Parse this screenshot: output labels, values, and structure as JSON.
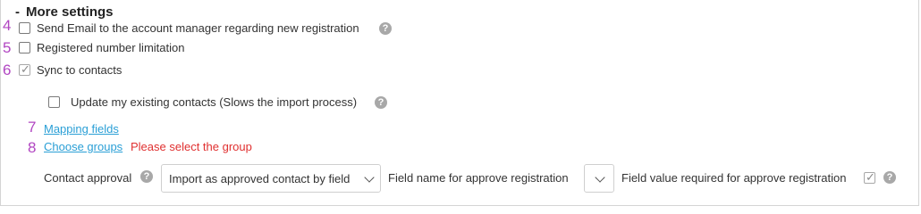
{
  "theme": {
    "number_color": "#b146c2",
    "link_color": "#2a9fd6",
    "error_color": "#e03030",
    "help_color": "#a8a8a8"
  },
  "section": {
    "collapse_glyph": "-",
    "title": "More settings"
  },
  "options": [
    {
      "number": "4",
      "label": "Send Email to the account manager regarding new registration",
      "checked": false
    },
    {
      "number": "5",
      "label": "Registered number limitation",
      "checked": false
    },
    {
      "number": "6",
      "label": "Sync to contacts",
      "checked": true
    }
  ],
  "update_contacts": {
    "label": "Update my existing contacts (Slows the import process)",
    "checked": false
  },
  "mapping": {
    "number": "7",
    "link": "Mapping fields"
  },
  "groups": {
    "number": "8",
    "link": "Choose groups",
    "error": "Please select the group"
  },
  "approval": {
    "label": "Contact approval",
    "select_value": "Import as approved contact by field",
    "field_name_label": "Field name for approve registration",
    "field_name_value": "",
    "field_value_label": "Field value required for approve registration",
    "field_value_checked": true
  },
  "icons": {
    "help": "help-circle-icon",
    "chevron": "chevron-down-icon",
    "check": "check-icon"
  }
}
